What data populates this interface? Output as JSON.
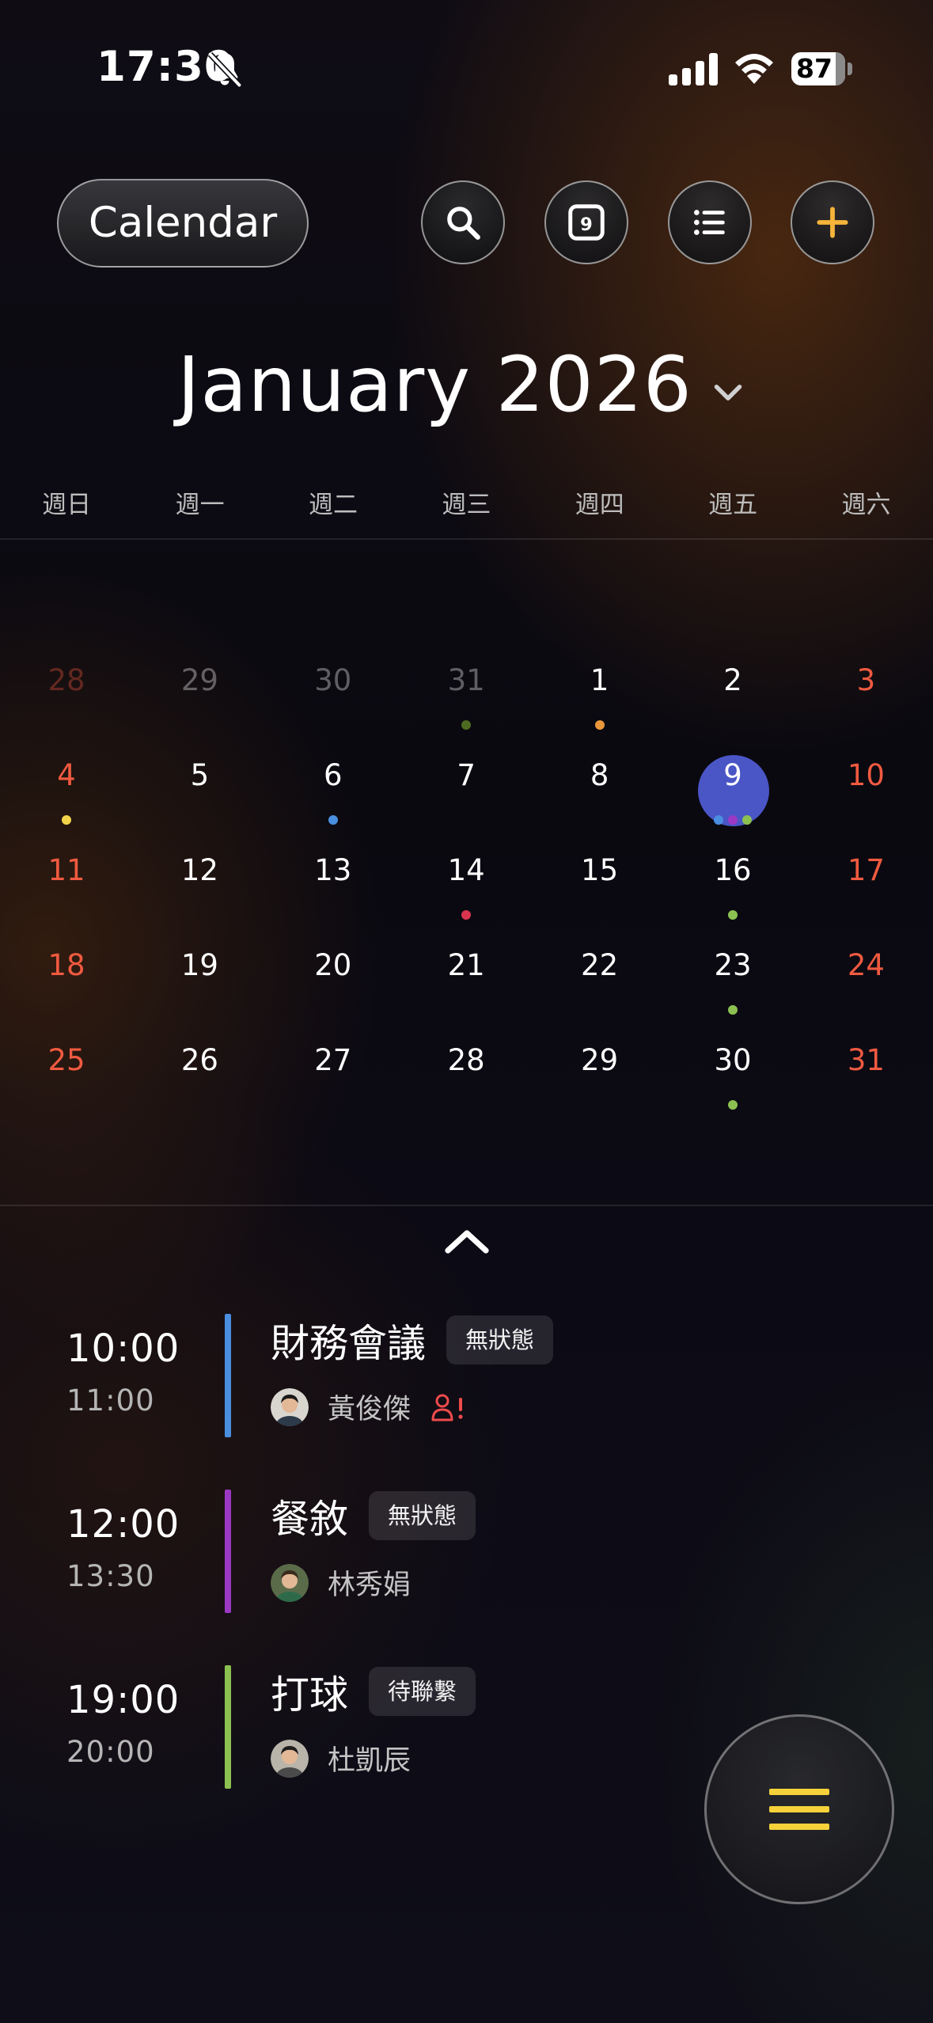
{
  "status_bar": {
    "time": "17:30",
    "battery": "87"
  },
  "header": {
    "calendar_label": "Calendar",
    "month_title": "January 2026"
  },
  "weekdays": [
    "週日",
    "週一",
    "週二",
    "週三",
    "週四",
    "週五",
    "週六"
  ],
  "calendar": {
    "weeks": [
      [
        {
          "day": "28",
          "muted": true,
          "weekend": true
        },
        {
          "day": "29",
          "muted": true
        },
        {
          "day": "30",
          "muted": true
        },
        {
          "day": "31",
          "muted": true,
          "dots": [
            "#4e6b22"
          ]
        },
        {
          "day": "1",
          "dots": [
            "#e9973a"
          ]
        },
        {
          "day": "2"
        },
        {
          "day": "3",
          "weekend": true
        }
      ],
      [
        {
          "day": "4",
          "weekend": true,
          "dots": [
            "#f2d44a"
          ]
        },
        {
          "day": "5"
        },
        {
          "day": "6",
          "dots": [
            "#4a8ee0"
          ]
        },
        {
          "day": "7"
        },
        {
          "day": "8"
        },
        {
          "day": "9",
          "today": true,
          "dots": [
            "#4a8ee0",
            "#9b39c4",
            "#8cc152"
          ]
        },
        {
          "day": "10",
          "weekend": true
        }
      ],
      [
        {
          "day": "11",
          "weekend": true
        },
        {
          "day": "12"
        },
        {
          "day": "13"
        },
        {
          "day": "14",
          "dots": [
            "#d8344f"
          ]
        },
        {
          "day": "15"
        },
        {
          "day": "16",
          "dots": [
            "#8cc152"
          ]
        },
        {
          "day": "17",
          "weekend": true
        }
      ],
      [
        {
          "day": "18",
          "weekend": true
        },
        {
          "day": "19"
        },
        {
          "day": "20"
        },
        {
          "day": "21"
        },
        {
          "day": "22"
        },
        {
          "day": "23",
          "dots": [
            "#8cc152"
          ]
        },
        {
          "day": "24",
          "weekend": true
        }
      ],
      [
        {
          "day": "25",
          "weekend": true
        },
        {
          "day": "26"
        },
        {
          "day": "27"
        },
        {
          "day": "28"
        },
        {
          "day": "29"
        },
        {
          "day": "30",
          "dots": [
            "#8cc152"
          ]
        },
        {
          "day": "31",
          "weekend": true
        }
      ]
    ]
  },
  "events": [
    {
      "start": "10:00",
      "end": "11:00",
      "title": "財務會議",
      "status": "無狀態",
      "person": "黃俊傑",
      "color": "#4a8ee0",
      "alert": true
    },
    {
      "start": "12:00",
      "end": "13:30",
      "title": "餐敘",
      "status": "無狀態",
      "person": "林秀娟",
      "color": "#9b39c4",
      "alert": false
    },
    {
      "start": "19:00",
      "end": "20:00",
      "title": "打球",
      "status": "待聯繫",
      "person": "杜凱辰",
      "color": "#8cc152",
      "alert": false
    }
  ],
  "colors": {
    "weekend": "#f05a40",
    "today": "#4a56c6",
    "accent_plus": "#f5b43a",
    "fab_menu": "#f5d23a"
  },
  "icons": [
    "bell-off-icon",
    "signal-icon",
    "wifi-icon",
    "search-icon",
    "today-calendar-icon",
    "list-icon",
    "plus-icon",
    "chevron-down-icon",
    "chevron-up-icon",
    "person-alert-icon",
    "menu-icon"
  ]
}
